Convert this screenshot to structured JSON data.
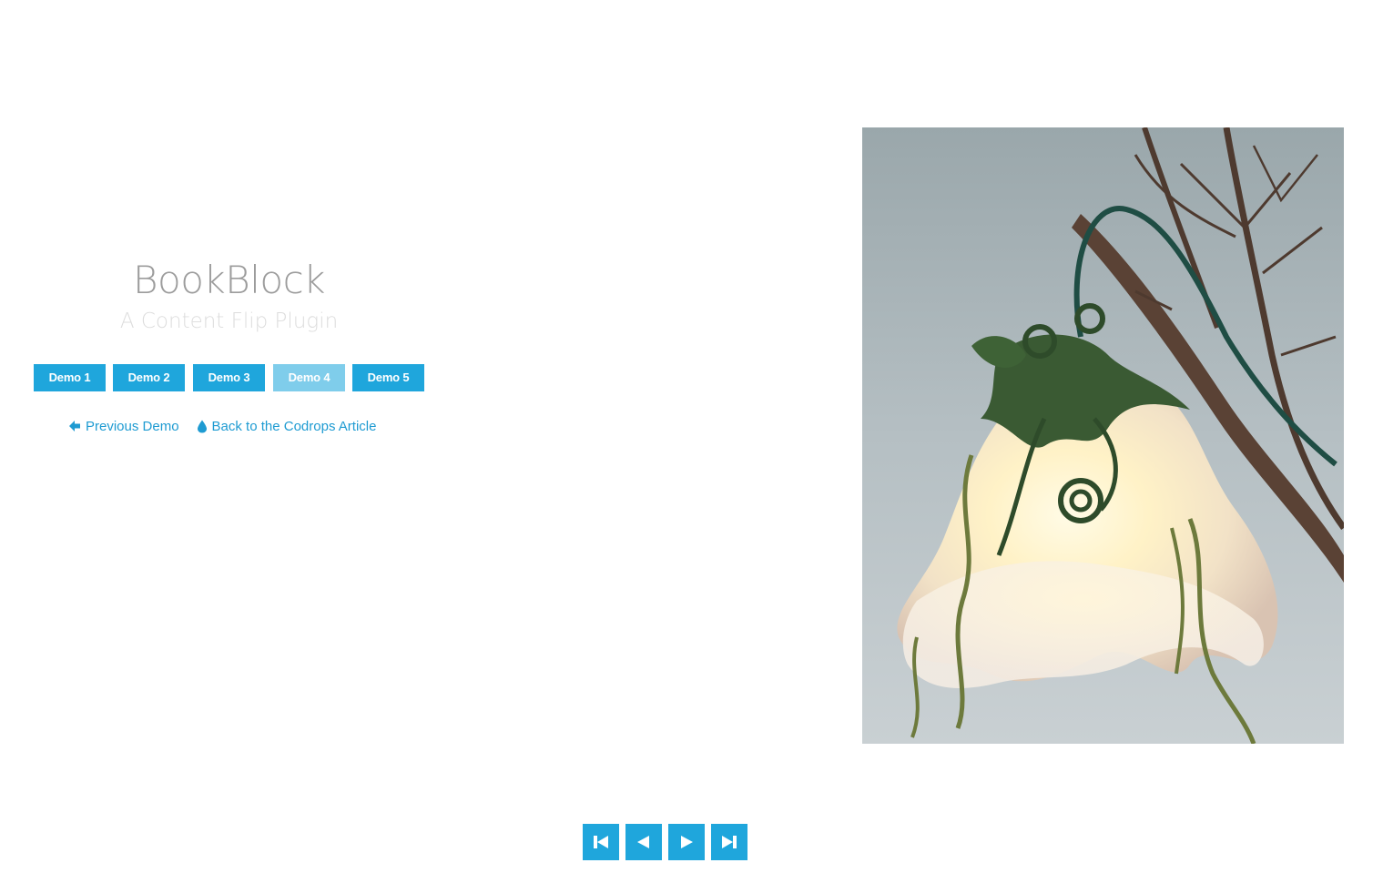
{
  "header": {
    "title": "BookBlock",
    "subtitle": "A Content Flip Plugin"
  },
  "demos": {
    "items": [
      "Demo 1",
      "Demo 2",
      "Demo 3",
      "Demo 4",
      "Demo 5"
    ],
    "current_index": 3
  },
  "links": {
    "previous_demo": "Previous Demo",
    "back_to_article": "Back to the Codrops Article"
  },
  "book": {
    "image_icon": "felt-flower-lamp-photo"
  },
  "navigation": {
    "first_icon": "first-page-icon",
    "prev_icon": "previous-page-icon",
    "next_icon": "next-page-icon",
    "last_icon": "last-page-icon"
  },
  "colors": {
    "accent": "#1fa6dc",
    "accent_current": "#7fcdeb",
    "link": "#1e9bd2",
    "title": "#9c9c9c",
    "subtitle": "#dddddd"
  }
}
